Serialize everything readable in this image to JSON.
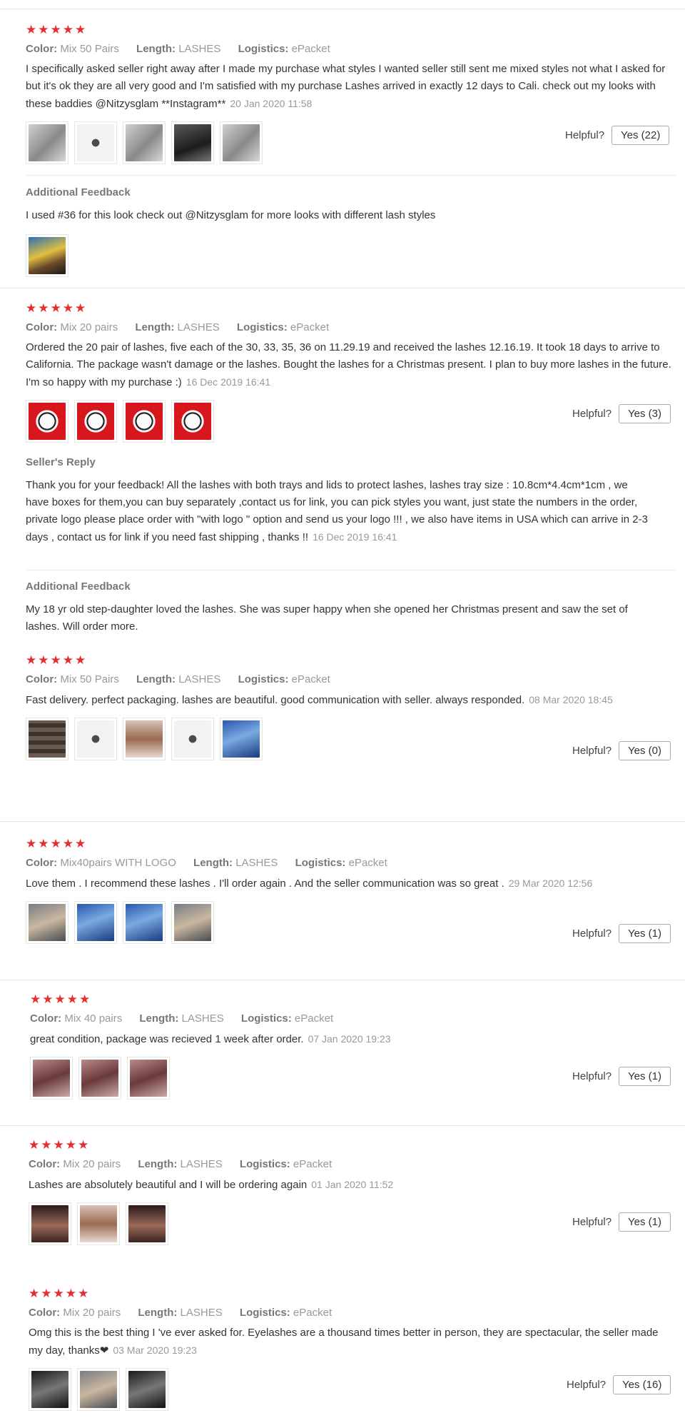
{
  "helpful_label": "Helpful?",
  "meta_keys": {
    "color": "Color:",
    "length": "Length:",
    "logistics": "Logistics:"
  },
  "stars": "★★★★★",
  "additional_feedback_label": "Additional Feedback",
  "seller_reply_label": "Seller's Reply",
  "reviews": [
    {
      "color": "Mix 50 Pairs",
      "length": "LASHES",
      "logistics": "ePacket",
      "text": "I specifically asked seller right away after I made my purchase what styles I wanted seller still sent me mixed styles not what I asked for but it's ok they are all very good and I'm satisfied with my purchase Lashes arrived in exactly 12 days to Cali. check out my looks with these baddies @Nitzysglam **Instagram**",
      "date": "20 Jan 2020 11:58",
      "helpful_button": "Yes (22)",
      "additional_feedback": "I used #36 for this look check out @Nitzysglam for more looks with different lash styles"
    },
    {
      "color": "Mix 20 pairs",
      "length": "LASHES",
      "logistics": "ePacket",
      "text": "Ordered the 20 pair of lashes, five each of the 30, 33, 35, 36 on 11.29.19 and received the lashes 12.16.19. It took 18 days to arrive to California. The package wasn't damage or the lashes. Bought the lashes for a Christmas present. I plan to buy more lashes in the future. I'm so happy with my purchase :)",
      "date": "16 Dec 2019 16:41",
      "helpful_button": "Yes (3)",
      "seller_reply": "Thank you for your feedback! All the lashes with both trays and lids to protect lashes, lashes tray size : 10.8cm*4.4cm*1cm , we have boxes for them,you can buy separately ,contact us for link, you can pick styles you want, just state the numbers in the order, private logo please place order with \"with logo \" option and send us your logo !!! , we also have items in USA which can arrive in 2-3 days , contact us for link if you need fast shipping , thanks !!",
      "seller_reply_date": "16 Dec 2019 16:41",
      "additional_feedback": "My 18 yr old step-daughter loved the lashes. She was super happy when she opened her Christmas present and saw the set of lashes. Will order more."
    },
    {
      "color": "Mix 50 Pairs",
      "length": "LASHES",
      "logistics": "ePacket",
      "text": "Fast delivery. perfect packaging. lashes are beautiful. good communication with seller. always responded.",
      "date": "08 Mar 2020 18:45",
      "helpful_button": "Yes (0)"
    },
    {
      "color": "Mix40pairs WITH LOGO",
      "length": "LASHES",
      "logistics": "ePacket",
      "text": "Love them . I recommend these lashes . I'll order again . And the seller communication was so great .",
      "date": "29 Mar 2020 12:56",
      "helpful_button": "Yes (1)"
    },
    {
      "color": "Mix 40 pairs",
      "length": "LASHES",
      "logistics": "ePacket",
      "text": "great condition, package was recieved 1 week after order.",
      "date": "07 Jan 2020 19:23",
      "helpful_button": "Yes (1)"
    },
    {
      "color": "Mix 20 pairs",
      "length": "LASHES",
      "logistics": "ePacket",
      "text": "Lashes are absolutely beautiful and I will be ordering again",
      "date": "01 Jan 2020 11:52",
      "helpful_button": "Yes (1)"
    },
    {
      "color": "Mix 20 pairs",
      "length": "LASHES",
      "logistics": "ePacket",
      "text": "Omg this is the best thing I 've ever asked for. Eyelashes are a thousand times better in person, they are spectacular, the seller made my day, thanks❤",
      "date": "03 Mar 2020 19:23",
      "helpful_button": "Yes (16)"
    }
  ],
  "colors": {
    "star": "#e62e2e",
    "meta_value": "#999999",
    "text": "#333333"
  }
}
